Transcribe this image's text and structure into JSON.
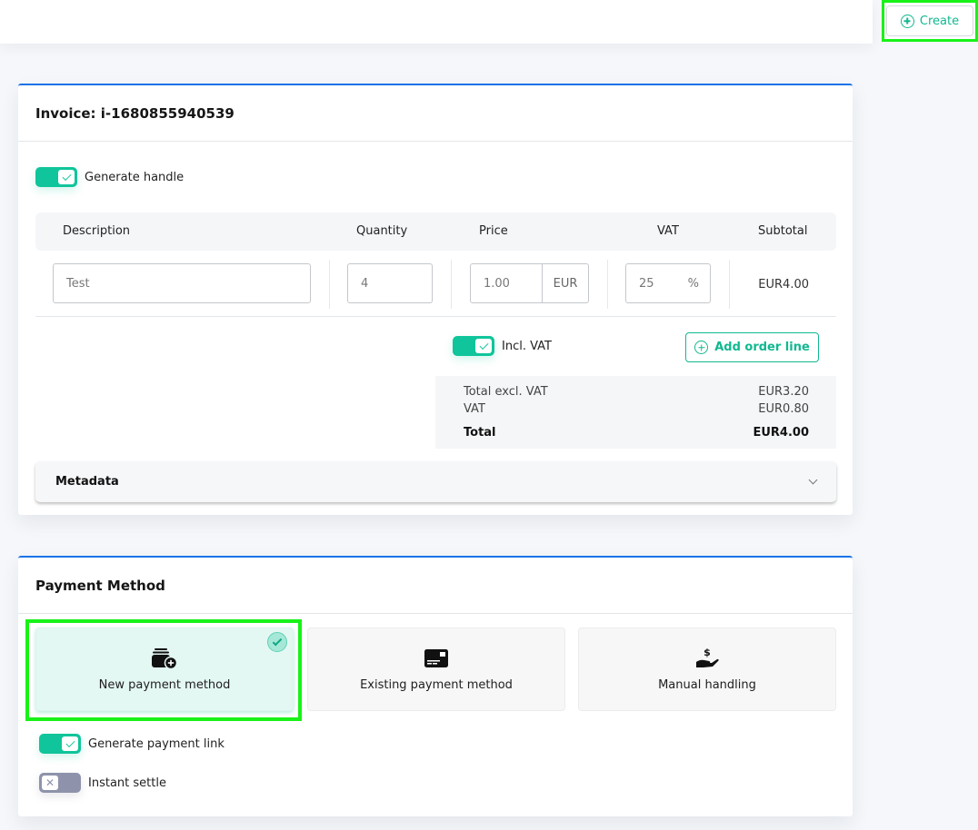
{
  "header": {
    "create_label": "Create",
    "create_icon": "plus-circle-icon"
  },
  "invoice": {
    "title": "Invoice: i-1680855940539",
    "generate_handle": {
      "label": "Generate handle",
      "checked": true
    },
    "table": {
      "columns": [
        "Description",
        "Quantity",
        "Price",
        "VAT",
        "Subtotal"
      ],
      "rows": [
        {
          "description": "Test",
          "quantity": "4",
          "price": "1.00",
          "currency": "EUR",
          "vat": "25",
          "vat_suffix": "%",
          "subtotal": "EUR4.00"
        }
      ]
    },
    "incl_vat": {
      "label": "Incl. VAT",
      "checked": true
    },
    "add_order_line_label": "Add order line",
    "totals": {
      "excl_vat_label": "Total excl. VAT",
      "excl_vat_value": "EUR3.20",
      "vat_label": "VAT",
      "vat_value": "EUR0.80",
      "total_label": "Total",
      "total_value": "EUR4.00"
    },
    "metadata_label": "Metadata"
  },
  "payment": {
    "title": "Payment Method",
    "options": [
      {
        "label": "New payment method",
        "icon": "wallet-add-icon",
        "selected": true
      },
      {
        "label": "Existing payment method",
        "icon": "credit-card-icon",
        "selected": false
      },
      {
        "label": "Manual handling",
        "icon": "hand-dollar-icon",
        "selected": false
      }
    ],
    "generate_payment_link": {
      "label": "Generate payment link",
      "checked": true
    },
    "instant_settle": {
      "label": "Instant settle",
      "checked": false
    }
  },
  "colors": {
    "accent": "#10c59b",
    "primary_border": "#1a73e8",
    "highlight": "#18f218",
    "toggle_off": "#8e93ab"
  }
}
